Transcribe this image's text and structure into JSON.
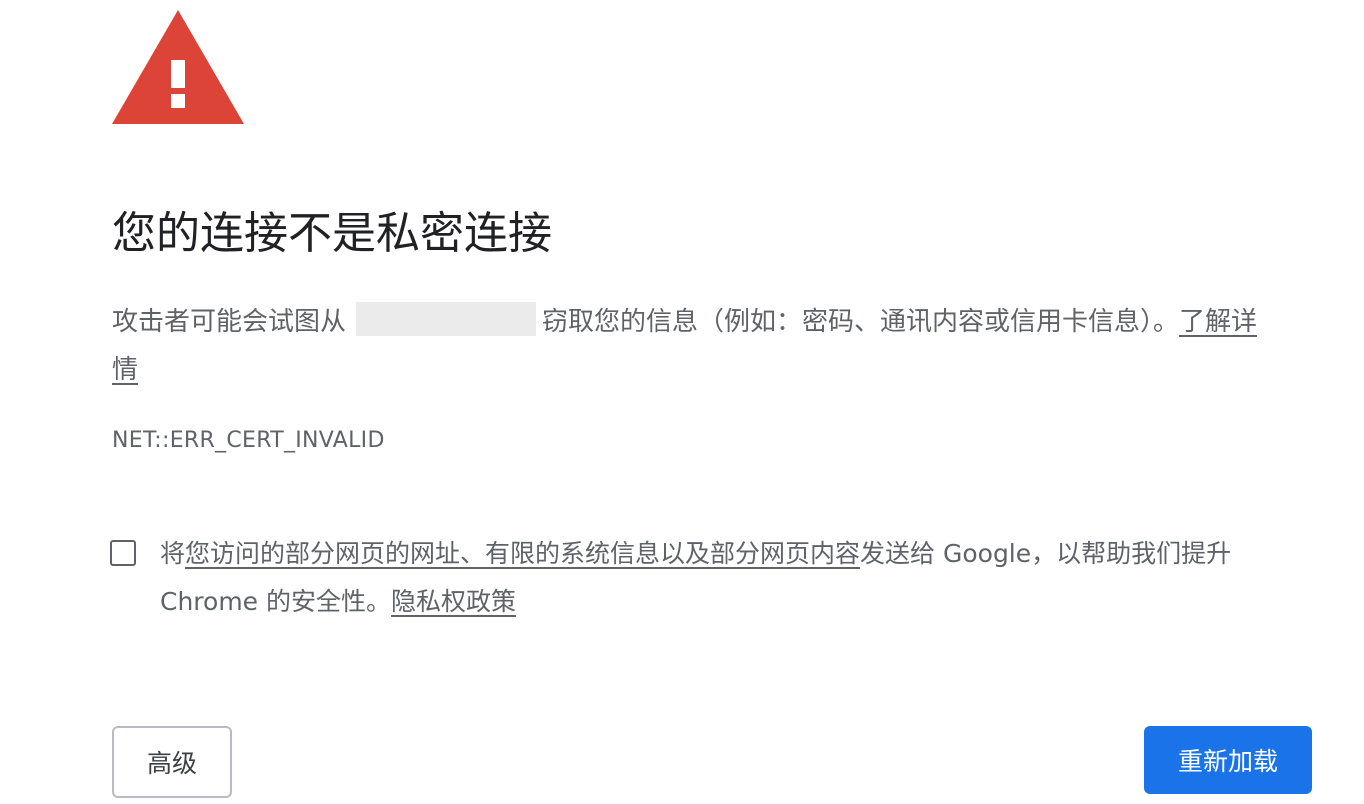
{
  "icon": {
    "name": "warning-triangle-icon",
    "color": "#db4437",
    "glyph_color": "#ffffff"
  },
  "title": "您的连接不是私密连接",
  "description": {
    "before": "攻击者可能会试图从",
    "after": "窃取您的信息（例如：密码、通讯内容或信用卡信息）。",
    "learn_more": "了解详情"
  },
  "error_code": "NET::ERR_CERT_INVALID",
  "optin": {
    "prefix": "将",
    "link_text": "您访问的部分网页的网址、有限的系统信息以及部分网页内容",
    "middle": "发送给 Google，以帮助我们提升 Chrome 的安全性。",
    "privacy_link": "隐私权政策",
    "checked": false
  },
  "buttons": {
    "advanced": "高级",
    "reload": "重新加载"
  },
  "colors": {
    "accent": "#1a73e8",
    "text_primary": "#202124",
    "text_secondary": "#5f6368",
    "warning": "#db4437"
  }
}
